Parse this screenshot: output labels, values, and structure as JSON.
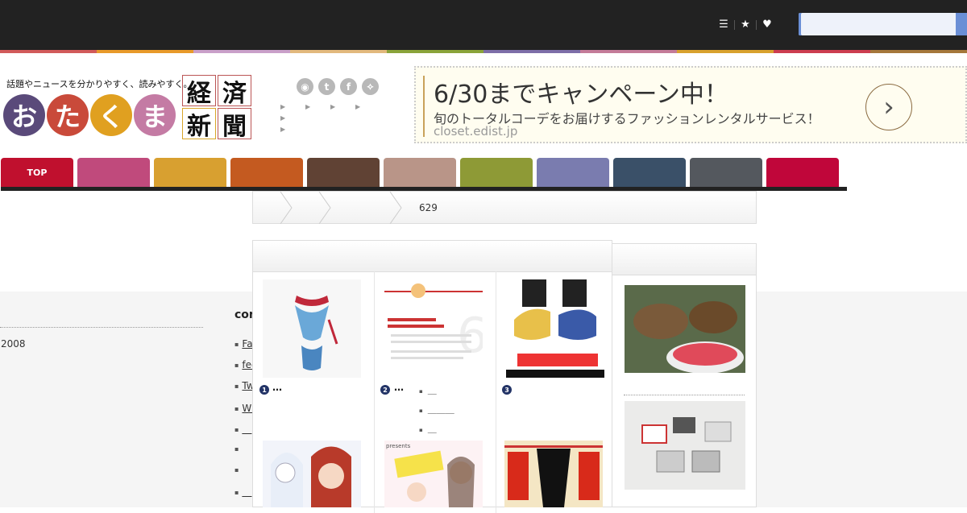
{
  "topbar": {
    "icons": [
      "list-icon",
      "star-icon",
      "heart-icon"
    ],
    "search_placeholder": ""
  },
  "stripe_colors": [
    "#d15a5a",
    "#e89a2a",
    "#c9a0c9",
    "#e2b97d",
    "#8aa33a",
    "#7d6ea8",
    "#c47b99",
    "#d8a12e",
    "#cc3d50",
    "#a5773b"
  ],
  "header": {
    "tagline": "話題やニュースを分かりやすく、読みやすく。",
    "logo": [
      {
        "char": "お",
        "color": "#5a4a7a"
      },
      {
        "char": "た",
        "color": "#c94a3a"
      },
      {
        "char": "く",
        "color": "#e0a020"
      },
      {
        "char": "ま",
        "color": "#c47ba4"
      }
    ],
    "kanji": [
      "経",
      "済",
      "新",
      "聞"
    ],
    "social": [
      {
        "icon": "rss-icon",
        "glyph": "◉"
      },
      {
        "icon": "twitter-icon",
        "glyph": "t"
      },
      {
        "icon": "facebook-icon",
        "glyph": "f"
      },
      {
        "icon": "feedly-icon",
        "glyph": "⟡"
      }
    ]
  },
  "ad": {
    "title": "6/30までキャンペーン中！",
    "description": "旬のトータルコーデをお届けするファッションレンタルサービス！",
    "url": "closet.edist.jp",
    "arrow_icon": "chevron-right-icon"
  },
  "nav": {
    "tabs": [
      {
        "label": "TOP",
        "color": "#c0102e"
      },
      {
        "label": "",
        "color": "#c04a7c"
      },
      {
        "label": "",
        "color": "#d8a030"
      },
      {
        "label": "",
        "color": "#c45a20"
      },
      {
        "label": "",
        "color": "#604234"
      },
      {
        "label": "",
        "color": "#b99588"
      },
      {
        "label": "",
        "color": "#8e9a36"
      },
      {
        "label": "",
        "color": "#7a7caf"
      },
      {
        "label": "",
        "color": "#3a5068"
      },
      {
        "label": "",
        "color": "#54585e"
      },
      {
        "label": "",
        "color": "#c0063a"
      }
    ]
  },
  "breadcrumb": {
    "count": "629"
  },
  "footer": {
    "year": "2008",
    "content_heading": "cont",
    "links": [
      "Face",
      "feed",
      "Twitter",
      "WEB＿＿",
      "＿",
      "",
      "",
      "＿"
    ]
  },
  "ranking": {
    "items": [
      {
        "rank": "1",
        "tail": "…"
      },
      {
        "rank": "2",
        "tail": "…"
      },
      {
        "rank": "3",
        "tail": ""
      }
    ],
    "sub_links": [
      "＿",
      "＿＿＿",
      "＿"
    ]
  }
}
